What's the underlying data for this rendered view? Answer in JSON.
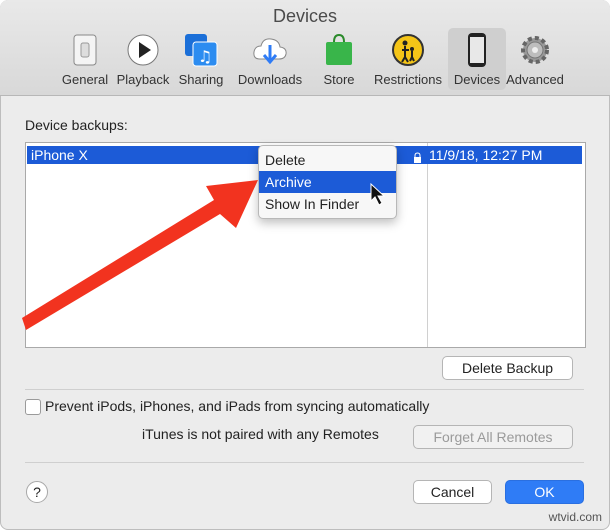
{
  "window": {
    "title": "Devices"
  },
  "toolbar": {
    "items": [
      {
        "label": "General",
        "icon": "toggle-switch-icon"
      },
      {
        "label": "Playback",
        "icon": "play-icon"
      },
      {
        "label": "Sharing",
        "icon": "music-notes-icon"
      },
      {
        "label": "Downloads",
        "icon": "cloud-download-icon"
      },
      {
        "label": "Store",
        "icon": "shopping-bag-icon"
      },
      {
        "label": "Restrictions",
        "icon": "parental-icon"
      },
      {
        "label": "Devices",
        "icon": "iphone-icon",
        "active": true
      },
      {
        "label": "Advanced",
        "icon": "gear-icon"
      }
    ]
  },
  "backups": {
    "label": "Device backups:",
    "rows": [
      {
        "name": "iPhone X",
        "date": "11/9/18, 12:27 PM",
        "locked": true
      }
    ]
  },
  "context_menu": {
    "items": [
      "Delete",
      "Archive",
      "Show In Finder"
    ],
    "highlighted": "Archive"
  },
  "buttons": {
    "delete_backup": "Delete Backup",
    "forget_remotes": "Forget All Remotes",
    "cancel": "Cancel",
    "ok": "OK",
    "help": "?"
  },
  "options": {
    "prevent_sync_label": "Prevent iPods, iPhones, and iPads from syncing automatically",
    "prevent_sync_checked": false,
    "remotes_status": "iTunes is not paired with any Remotes"
  },
  "watermark": "wtvid.com",
  "colors": {
    "selection": "#1c5bd7",
    "primary_button": "#2f7cf6",
    "annotation_arrow": "#f2331f"
  }
}
